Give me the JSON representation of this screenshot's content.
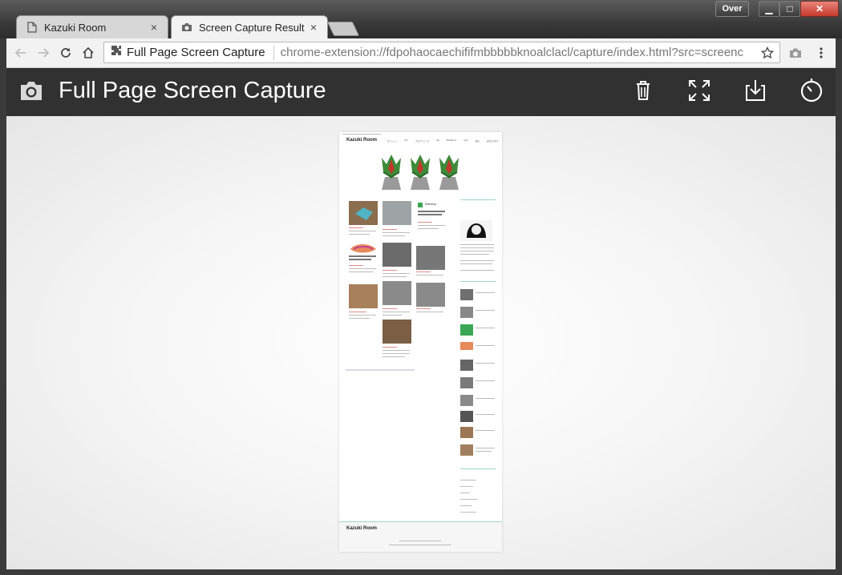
{
  "window": {
    "over_label": "Over",
    "minimize": "▁",
    "maximize": "□",
    "close": "✕"
  },
  "tabs": [
    {
      "label": "Kazuki Room",
      "icon": "page-icon",
      "close": "×",
      "active": false
    },
    {
      "label": "Screen Capture Result",
      "icon": "camera-icon",
      "close": "×",
      "active": true
    }
  ],
  "toolbar": {
    "omnibox_title": "Full Page Screen Capture",
    "url": "chrome-extension://fdpohaocaechififmbbbbbknoalclacl/capture/index.html?src=screenc"
  },
  "header": {
    "title": "Full Page Screen Capture",
    "actions": [
      "trash-icon",
      "fullscreen-icon",
      "download-icon",
      "timer-icon"
    ]
  },
  "capture": {
    "site_title": "Kazuki Room",
    "nav": [
      "ガジェット",
      "DIY",
      "プログラミング",
      "AR",
      "WordPress",
      "Unity",
      "雑記",
      "お問い合わせ"
    ],
    "footer_brand": "Kazuki Room",
    "featured_label": "Raindrop"
  }
}
